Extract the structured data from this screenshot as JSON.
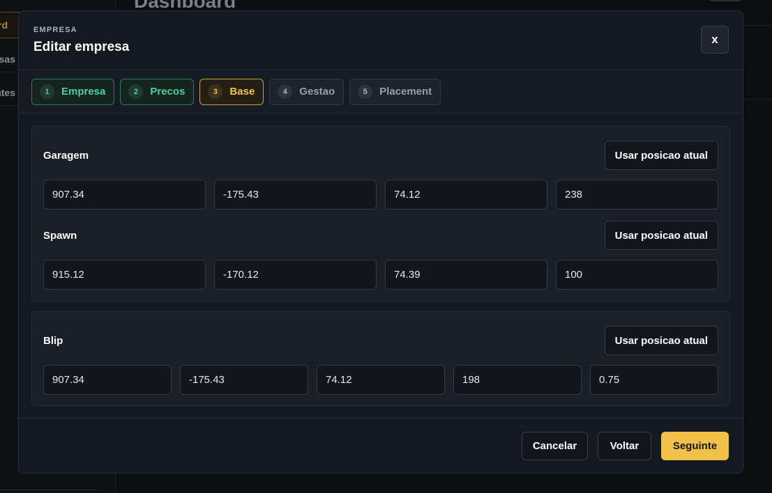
{
  "background": {
    "page_title": "Dashboard",
    "sidebar_items": [
      {
        "label": "Dashboard",
        "active": true
      },
      {
        "label": "Empresas",
        "active": false
      },
      {
        "label": "Entregas Pendentes",
        "active": false
      }
    ]
  },
  "modal": {
    "kicker": "EMPRESA",
    "title": "Editar empresa",
    "close_label": "x",
    "steps": [
      {
        "num": "1",
        "label": "Empresa",
        "state": "done"
      },
      {
        "num": "2",
        "label": "Precos",
        "state": "done"
      },
      {
        "num": "3",
        "label": "Base",
        "state": "current"
      },
      {
        "num": "4",
        "label": "Gestao",
        "state": "pending"
      },
      {
        "num": "5",
        "label": "Placement",
        "state": "pending"
      }
    ],
    "garagem": {
      "label": "Garagem",
      "button": "Usar posicao atual",
      "values": [
        "907.34",
        "-175.43",
        "74.12",
        "238"
      ]
    },
    "spawn": {
      "label": "Spawn",
      "button": "Usar posicao atual",
      "values": [
        "915.12",
        "-170.12",
        "74.39",
        "100"
      ]
    },
    "blip": {
      "label": "Blip",
      "button": "Usar posicao atual",
      "values": [
        "907.34",
        "-175.43",
        "74.12",
        "198",
        "0.75"
      ]
    },
    "footer": {
      "cancel": "Cancelar",
      "back": "Voltar",
      "next": "Seguinte"
    }
  },
  "colors": {
    "accent": "#f2c14a",
    "done": "#4ed29c",
    "modal_bg": "#141820"
  }
}
